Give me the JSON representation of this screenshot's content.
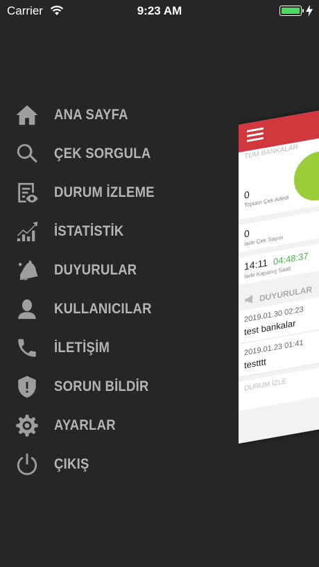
{
  "status_bar": {
    "carrier": "Carrier",
    "time": "9:23 AM",
    "battery_color": "#4cd964"
  },
  "menu": {
    "items": [
      {
        "label": "ANA SAYFA",
        "icon": "home-icon"
      },
      {
        "label": "ÇEK SORGULA",
        "icon": "search-icon"
      },
      {
        "label": "DURUM İZLEME",
        "icon": "status-watch-icon"
      },
      {
        "label": "İSTATİSTİK",
        "icon": "statistics-chart-icon"
      },
      {
        "label": "DUYURULAR",
        "icon": "megaphone-icon"
      },
      {
        "label": "KULLANICILAR",
        "icon": "user-icon"
      },
      {
        "label": "İLETİŞİM",
        "icon": "phone-icon"
      },
      {
        "label": "SORUN BİLDİR",
        "icon": "shield-alert-icon"
      },
      {
        "label": "AYARLAR",
        "icon": "gear-icon"
      },
      {
        "label": "ÇIKIŞ",
        "icon": "power-icon"
      }
    ]
  },
  "preview": {
    "accent": "#d0383e",
    "tab_label": "TÜM BANKALAR",
    "total_cheques_value": "0",
    "total_cheques_label": "Toplam Çek Adedi",
    "returned_value": "0",
    "returned_label": "İade Çek Sayısı",
    "closing_time": "14:11",
    "countdown": "04:48:37",
    "closing_label": "İade Kapanış Saati",
    "announcements_title": "DUYURULAR",
    "announcements": [
      {
        "date": "2019.01.30 02:23",
        "text": "test bankalar"
      },
      {
        "date": "2019.01.23 01:41",
        "text": "testttt"
      }
    ],
    "bottom_label": "DURUM İZLE"
  }
}
